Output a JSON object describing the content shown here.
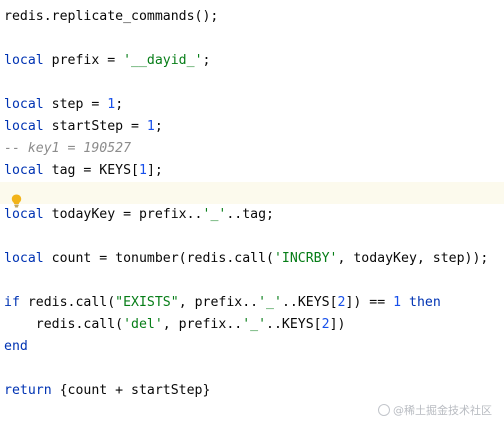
{
  "editor": {
    "lines": [
      [
        {
          "t": "redis.replicate_commands();"
        }
      ],
      [],
      [
        {
          "t": "local",
          "c": "kw"
        },
        {
          "t": " prefix = "
        },
        {
          "t": "'__dayid_'",
          "c": "str"
        },
        {
          "t": ";"
        }
      ],
      [],
      [
        {
          "t": "local",
          "c": "kw"
        },
        {
          "t": " step = "
        },
        {
          "t": "1",
          "c": "num"
        },
        {
          "t": ";"
        }
      ],
      [
        {
          "t": "local",
          "c": "kw"
        },
        {
          "t": " startStep = "
        },
        {
          "t": "1",
          "c": "num"
        },
        {
          "t": ";"
        }
      ],
      [
        {
          "t": "-- key1 = 190527",
          "c": "cmt"
        }
      ],
      [
        {
          "t": "local",
          "c": "kw"
        },
        {
          "t": " tag = KEYS["
        },
        {
          "t": "1",
          "c": "num"
        },
        {
          "t": "];"
        }
      ],
      [],
      [
        {
          "t": "local",
          "c": "kw"
        },
        {
          "t": " todayKey = prefix.."
        },
        {
          "t": "'_'",
          "c": "str"
        },
        {
          "t": "..tag;"
        }
      ],
      [],
      [
        {
          "t": "local",
          "c": "kw"
        },
        {
          "t": " count = tonumber(redis.call("
        },
        {
          "t": "'INCRBY'",
          "c": "str"
        },
        {
          "t": ", todayKey, step));"
        }
      ],
      [],
      [
        {
          "t": "if",
          "c": "kw"
        },
        {
          "t": " redis.call("
        },
        {
          "t": "\"EXISTS\"",
          "c": "str"
        },
        {
          "t": ", prefix.."
        },
        {
          "t": "'_'",
          "c": "str"
        },
        {
          "t": "..KEYS["
        },
        {
          "t": "2",
          "c": "num"
        },
        {
          "t": "]) == "
        },
        {
          "t": "1",
          "c": "num"
        },
        {
          "t": " "
        },
        {
          "t": "then",
          "c": "kw"
        }
      ],
      [
        {
          "t": "    redis.call("
        },
        {
          "t": "'del'",
          "c": "str"
        },
        {
          "t": ", prefix.."
        },
        {
          "t": "'_'",
          "c": "str"
        },
        {
          "t": "..KEYS["
        },
        {
          "t": "2",
          "c": "num"
        },
        {
          "t": "])"
        }
      ],
      [
        {
          "t": "end",
          "c": "kw"
        }
      ],
      [],
      [
        {
          "t": "return",
          "c": "kw"
        },
        {
          "t": " {count + startStep}"
        }
      ]
    ],
    "current_line_index": 8,
    "bulb_icon": "intention-bulb-icon",
    "colors": {
      "keyword": "#0033b3",
      "string": "#067d17",
      "number": "#1750eb",
      "comment": "#8c8c8c",
      "current_line": "#fcfaed"
    }
  },
  "watermark": {
    "text": "@稀土掘金技术社区"
  }
}
